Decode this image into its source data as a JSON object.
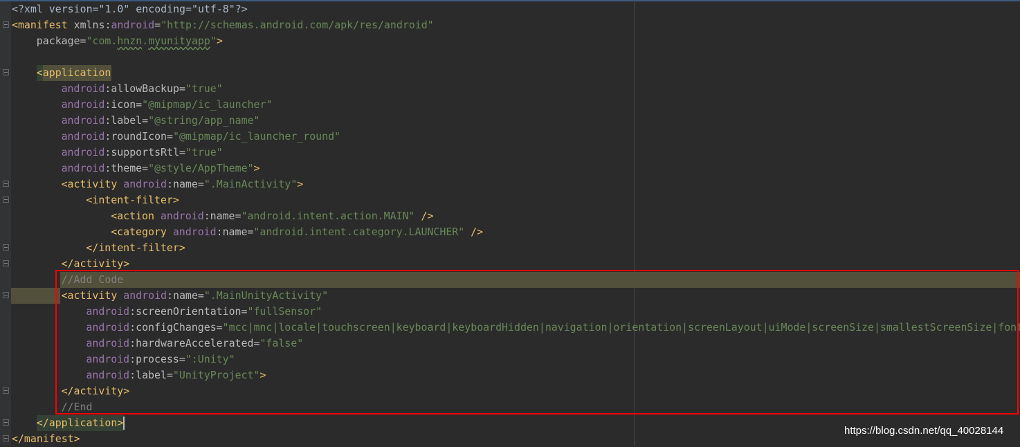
{
  "editor": {
    "lines": [
      {
        "indent": 0,
        "fold": false,
        "tokens": [
          {
            "k": "plain",
            "t": "<?xml version=\"1.0\" encoding=\"utf-8\"?>"
          }
        ]
      },
      {
        "indent": 0,
        "fold": true,
        "tokens": [
          {
            "k": "tag",
            "t": "<manifest "
          },
          {
            "k": "attr",
            "t": "xmlns:"
          },
          {
            "k": "ns",
            "t": "android"
          },
          {
            "k": "attr",
            "t": "="
          },
          {
            "k": "str",
            "t": "\"http://schemas.android.com/apk/res/android\""
          }
        ]
      },
      {
        "indent": 1,
        "fold": false,
        "tokens": [
          {
            "k": "attr",
            "t": "package="
          },
          {
            "k": "str",
            "t": "\"com."
          },
          {
            "k": "str sq",
            "t": "hnzn"
          },
          {
            "k": "str",
            "t": "."
          },
          {
            "k": "str sq",
            "t": "myunityapp"
          },
          {
            "k": "str",
            "t": "\""
          },
          {
            "k": "tag",
            "t": ">"
          }
        ]
      },
      {
        "indent": 0,
        "fold": false,
        "tokens": []
      },
      {
        "indent": 1,
        "fold": true,
        "tokens": [
          {
            "k": "tag",
            "t": "<application"
          }
        ]
      },
      {
        "indent": 2,
        "fold": false,
        "tokens": [
          {
            "k": "ns",
            "t": "android"
          },
          {
            "k": "attr",
            "t": ":allowBackup="
          },
          {
            "k": "str",
            "t": "\"true\""
          }
        ]
      },
      {
        "indent": 2,
        "fold": false,
        "tokens": [
          {
            "k": "ns",
            "t": "android"
          },
          {
            "k": "attr",
            "t": ":icon="
          },
          {
            "k": "str",
            "t": "\"@mipmap/ic_launcher\""
          }
        ]
      },
      {
        "indent": 2,
        "fold": false,
        "tokens": [
          {
            "k": "ns",
            "t": "android"
          },
          {
            "k": "attr",
            "t": ":label="
          },
          {
            "k": "str",
            "t": "\"@string/app_name\""
          }
        ]
      },
      {
        "indent": 2,
        "fold": false,
        "tokens": [
          {
            "k": "ns",
            "t": "android"
          },
          {
            "k": "attr",
            "t": ":roundIcon="
          },
          {
            "k": "str",
            "t": "\"@mipmap/ic_launcher_round\""
          }
        ]
      },
      {
        "indent": 2,
        "fold": false,
        "tokens": [
          {
            "k": "ns",
            "t": "android"
          },
          {
            "k": "attr",
            "t": ":supportsRtl="
          },
          {
            "k": "str",
            "t": "\"true\""
          }
        ]
      },
      {
        "indent": 2,
        "fold": false,
        "tokens": [
          {
            "k": "ns",
            "t": "android"
          },
          {
            "k": "attr",
            "t": ":theme="
          },
          {
            "k": "str",
            "t": "\"@style/AppTheme\""
          },
          {
            "k": "tag",
            "t": ">"
          }
        ]
      },
      {
        "indent": 2,
        "fold": true,
        "tokens": [
          {
            "k": "tag",
            "t": "<activity "
          },
          {
            "k": "ns",
            "t": "android"
          },
          {
            "k": "attr",
            "t": ":name="
          },
          {
            "k": "str",
            "t": "\".MainActivity\""
          },
          {
            "k": "tag",
            "t": ">"
          }
        ]
      },
      {
        "indent": 3,
        "fold": true,
        "tokens": [
          {
            "k": "tag",
            "t": "<intent-filter>"
          }
        ]
      },
      {
        "indent": 4,
        "fold": false,
        "tokens": [
          {
            "k": "tag",
            "t": "<action "
          },
          {
            "k": "ns",
            "t": "android"
          },
          {
            "k": "attr",
            "t": ":name="
          },
          {
            "k": "str",
            "t": "\"android.intent.action.MAIN\""
          },
          {
            "k": "tag",
            "t": " />"
          }
        ]
      },
      {
        "indent": 4,
        "fold": false,
        "tokens": [
          {
            "k": "tag",
            "t": "<category "
          },
          {
            "k": "ns",
            "t": "android"
          },
          {
            "k": "attr",
            "t": ":name="
          },
          {
            "k": "str",
            "t": "\"android.intent.category.LAUNCHER\""
          },
          {
            "k": "tag",
            "t": " />"
          }
        ]
      },
      {
        "indent": 3,
        "fold": true,
        "tokens": [
          {
            "k": "tag",
            "t": "</intent-filter>"
          }
        ]
      },
      {
        "indent": 2,
        "fold": true,
        "tokens": [
          {
            "k": "tag",
            "t": "</activity>"
          }
        ]
      },
      {
        "indent": 2,
        "fold": false,
        "hl": "line",
        "tokens": [
          {
            "k": "cmt",
            "t": "//Add Code"
          }
        ]
      },
      {
        "indent": 2,
        "fold": true,
        "hl": "indent",
        "tokens": [
          {
            "k": "tag",
            "t": "<activity "
          },
          {
            "k": "ns",
            "t": "android"
          },
          {
            "k": "attr",
            "t": ":name="
          },
          {
            "k": "str",
            "t": "\".MainUnityActivity\""
          }
        ]
      },
      {
        "indent": 3,
        "fold": false,
        "tokens": [
          {
            "k": "ns",
            "t": "android"
          },
          {
            "k": "attr",
            "t": ":screenOrientation="
          },
          {
            "k": "str",
            "t": "\"fullSensor\""
          }
        ]
      },
      {
        "indent": 3,
        "fold": false,
        "tokens": [
          {
            "k": "ns",
            "t": "android"
          },
          {
            "k": "attr",
            "t": ":configChanges="
          },
          {
            "k": "str",
            "t": "\"mcc|mnc|locale|touchscreen|keyboard|keyboardHidden|navigation|orientation|screenLayout|uiMode|screenSize|smallestScreenSize|fontScale\""
          }
        ]
      },
      {
        "indent": 3,
        "fold": false,
        "tokens": [
          {
            "k": "ns",
            "t": "android"
          },
          {
            "k": "attr",
            "t": ":hardwareAccelerated="
          },
          {
            "k": "str",
            "t": "\"false\""
          }
        ]
      },
      {
        "indent": 3,
        "fold": false,
        "tokens": [
          {
            "k": "ns",
            "t": "android"
          },
          {
            "k": "attr",
            "t": ":process="
          },
          {
            "k": "str",
            "t": "\":Unity\""
          }
        ]
      },
      {
        "indent": 3,
        "fold": false,
        "tokens": [
          {
            "k": "ns",
            "t": "android"
          },
          {
            "k": "attr",
            "t": ":label="
          },
          {
            "k": "str",
            "t": "\"UnityProject\""
          },
          {
            "k": "tag",
            "t": ">"
          }
        ]
      },
      {
        "indent": 2,
        "fold": true,
        "tokens": [
          {
            "k": "tag",
            "t": "</activity>"
          }
        ]
      },
      {
        "indent": 2,
        "fold": false,
        "tokens": [
          {
            "k": "cmt",
            "t": "//End"
          }
        ]
      },
      {
        "indent": 1,
        "fold": true,
        "hl": "close",
        "tokens": [
          {
            "k": "tag",
            "t": "</application"
          },
          {
            "k": "tag",
            "t": ">"
          }
        ]
      },
      {
        "indent": 0,
        "fold": true,
        "tokens": [
          {
            "k": "tag",
            "t": "</manifest>"
          }
        ]
      }
    ]
  },
  "watermark": "https://blog.csdn.net/qq_40028144",
  "colors": {
    "background": "#2b2b2b",
    "tag": "#e8bf6a",
    "namespace": "#9876aa",
    "string": "#6a8759",
    "comment": "#808080",
    "highlight_box": "#ff0000"
  }
}
